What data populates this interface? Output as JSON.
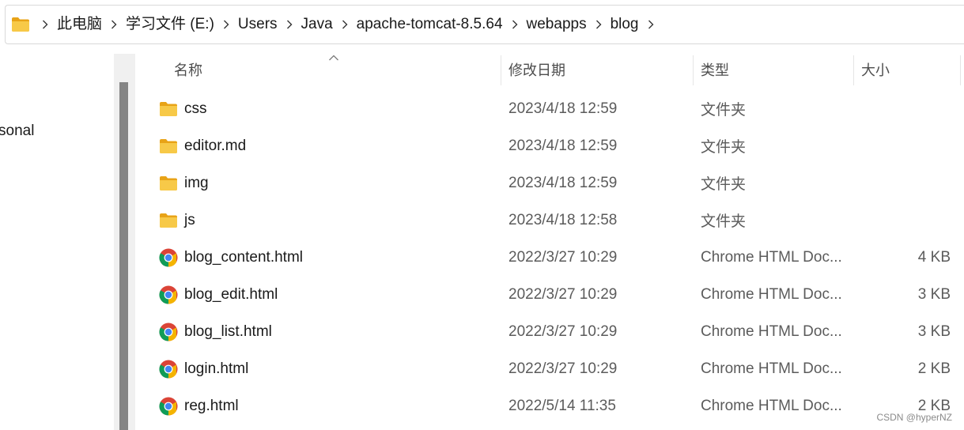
{
  "breadcrumb": {
    "items": [
      "此电脑",
      "学习文件 (E:)",
      "Users",
      "Java",
      "apache-tomcat-8.5.64",
      "webapps",
      "blog"
    ]
  },
  "nav": {
    "partial_label": "sonal"
  },
  "columns": {
    "name": "名称",
    "date": "修改日期",
    "type": "类型",
    "size": "大小"
  },
  "files": [
    {
      "name": "css",
      "date": "2023/4/18 12:59",
      "type": "文件夹",
      "size": "",
      "icon": "folder-icon"
    },
    {
      "name": "editor.md",
      "date": "2023/4/18 12:59",
      "type": "文件夹",
      "size": "",
      "icon": "folder-icon"
    },
    {
      "name": "img",
      "date": "2023/4/18 12:59",
      "type": "文件夹",
      "size": "",
      "icon": "folder-icon"
    },
    {
      "name": "js",
      "date": "2023/4/18 12:58",
      "type": "文件夹",
      "size": "",
      "icon": "folder-icon"
    },
    {
      "name": "blog_content.html",
      "date": "2022/3/27 10:29",
      "type": "Chrome HTML Doc...",
      "size": "4 KB",
      "icon": "chrome-html-icon"
    },
    {
      "name": "blog_edit.html",
      "date": "2022/3/27 10:29",
      "type": "Chrome HTML Doc...",
      "size": "3 KB",
      "icon": "chrome-html-icon"
    },
    {
      "name": "blog_list.html",
      "date": "2022/3/27 10:29",
      "type": "Chrome HTML Doc...",
      "size": "3 KB",
      "icon": "chrome-html-icon"
    },
    {
      "name": "login.html",
      "date": "2022/3/27 10:29",
      "type": "Chrome HTML Doc...",
      "size": "2 KB",
      "icon": "chrome-html-icon"
    },
    {
      "name": "reg.html",
      "date": "2022/5/14 11:35",
      "type": "Chrome HTML Doc...",
      "size": "2 KB",
      "icon": "chrome-html-icon"
    }
  ],
  "watermark": "CSDN @hyperNZ",
  "colors": {
    "folder": "#f7c948",
    "folder_dark": "#e8a317",
    "chrome_red": "#db4437",
    "chrome_yellow": "#f4b400",
    "chrome_green": "#0f9d58",
    "chrome_blue": "#4285f4"
  }
}
